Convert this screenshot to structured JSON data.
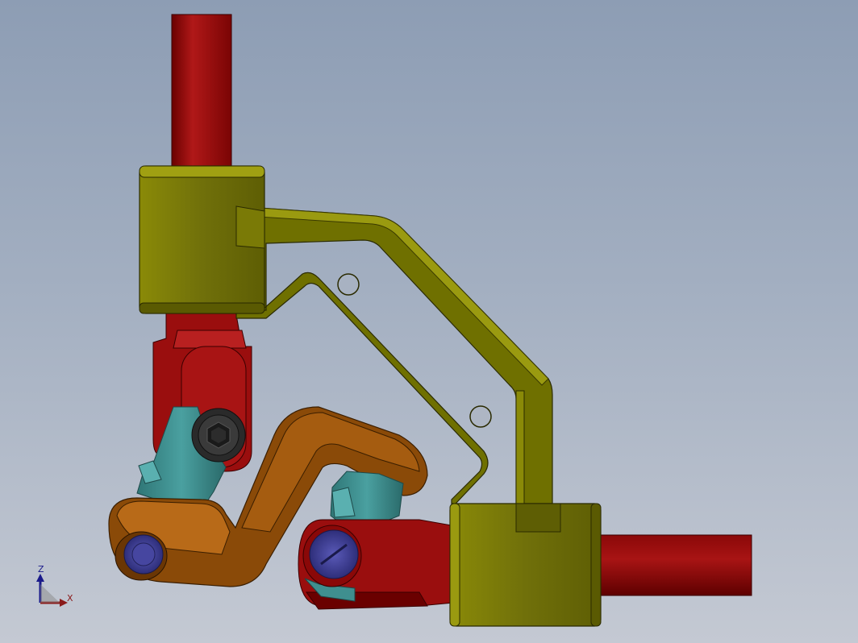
{
  "viewport": {
    "background_top": "#8d9db4",
    "background_bottom": "#c4c9d3"
  },
  "colors": {
    "red_shaft": "#a01010",
    "red_shaft_dark": "#6a0000",
    "yellow_bracket": "#6f7000",
    "yellow_bracket_light": "#9a9a10",
    "orange_link": "#8a4a08",
    "orange_link_light": "#b86a18",
    "teal_cross": "#3f8f8f",
    "blue_pin": "#4a4aa0"
  },
  "triad": {
    "z_label": "Z",
    "x_label": "X",
    "z_icon": "axis-z-arrow",
    "x_icon": "axis-x-arrow"
  }
}
